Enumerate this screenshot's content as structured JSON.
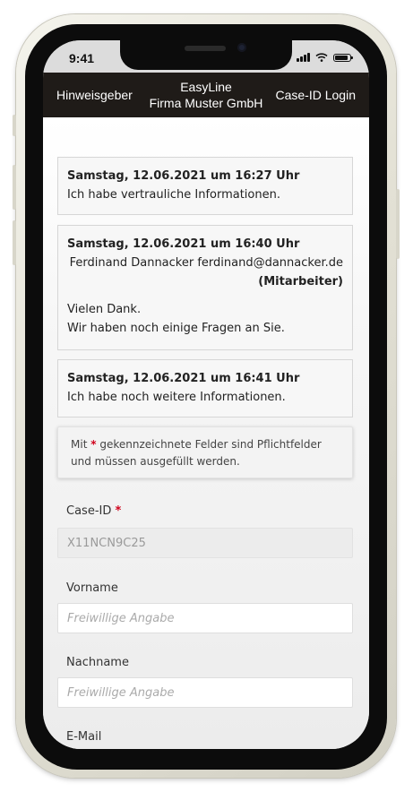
{
  "status_bar": {
    "time": "9:41"
  },
  "navbar": {
    "left_link": "Hinweisgeber",
    "center_line1": "EasyLine",
    "center_line2": "Firma Muster GmbH",
    "right_link": "Case-ID Login"
  },
  "messages": [
    {
      "date": "Samstag, 12.06.2021 um 16:27 Uhr",
      "text": "Ich habe vertrauliche Informationen."
    },
    {
      "date": "Samstag, 12.06.2021 um 16:40 Uhr",
      "sender": "Ferdinand Dannacker ferdinand@dannacker.de",
      "role": "(Mitarbeiter)",
      "line1": "Vielen Dank.",
      "line2": "Wir haben noch einige Fragen an Sie."
    },
    {
      "date": "Samstag, 12.06.2021 um 16:41 Uhr",
      "text": "Ich habe noch weitere Informationen."
    }
  ],
  "notice": {
    "prefix": "Mit",
    "asterisk": "*",
    "text": "gekennzeichnete Felder sind Pflichtfelder und müssen ausgefüllt werden."
  },
  "form": {
    "case_id": {
      "label": "Case-ID",
      "required_mark": "*",
      "value": "X11NCN9C25"
    },
    "vorname": {
      "label": "Vorname",
      "placeholder": "Freiwillige Angabe"
    },
    "nachname": {
      "label": "Nachname",
      "placeholder": "Freiwillige Angabe"
    },
    "email": {
      "label": "E-Mail"
    }
  },
  "colors": {
    "navbar_bg": "#1f1b18",
    "required_mark": "#d0021b",
    "device_frame": "#e4e2d6"
  }
}
